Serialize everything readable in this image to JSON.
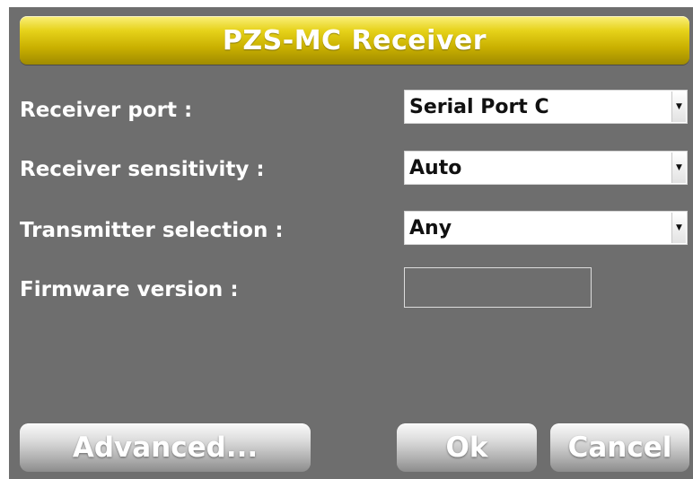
{
  "dialog": {
    "title": "PZS-MC Receiver"
  },
  "fields": {
    "receiver_port": {
      "label": "Receiver port :",
      "value": "Serial Port C"
    },
    "receiver_sensitivity": {
      "label": "Receiver sensitivity :",
      "value": "Auto"
    },
    "transmitter_selection": {
      "label": "Transmitter selection :",
      "value": "Any"
    },
    "firmware_version": {
      "label": "Firmware version :",
      "value": ""
    }
  },
  "buttons": {
    "advanced": "Advanced...",
    "ok": "Ok",
    "cancel": "Cancel"
  },
  "icons": {
    "dropdown": "dropdown-arrow-icon"
  },
  "colors": {
    "panel_background": "#6e6e6e",
    "title_bar_accent": "#d4bd00",
    "button_gray": "#c8c8c8"
  }
}
